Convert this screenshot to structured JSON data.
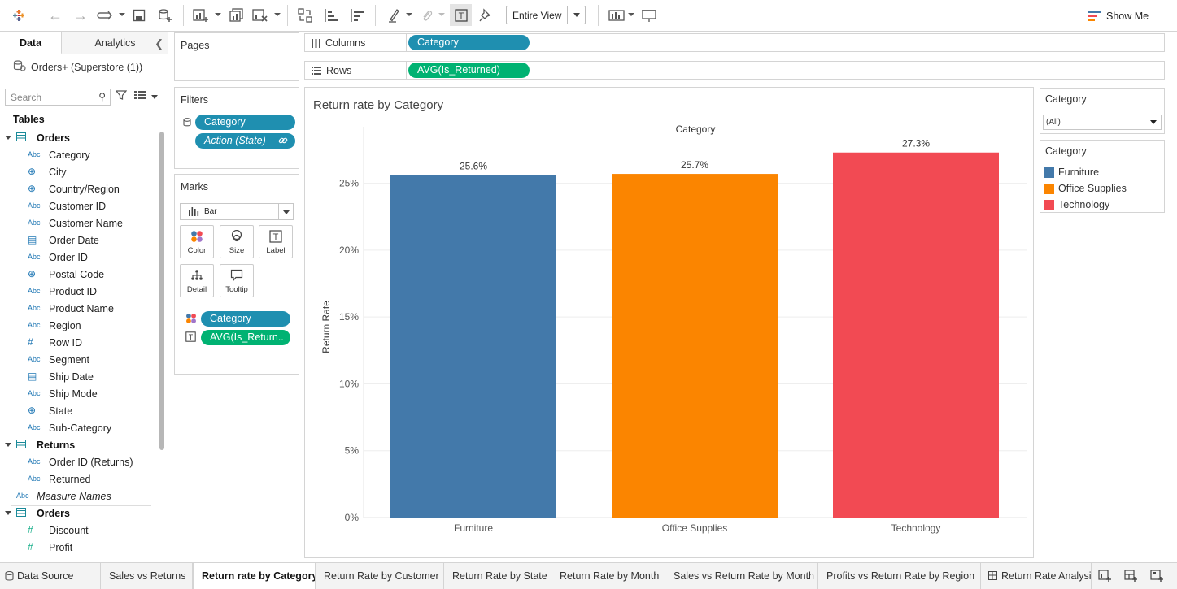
{
  "toolbar": {
    "fit_label": "Entire View",
    "show_me_label": "Show Me"
  },
  "data_pane": {
    "tabs": [
      "Data",
      "Analytics"
    ],
    "datasource": "Orders+ (Superstore (1))",
    "search_placeholder": "Search",
    "tables_label": "Tables",
    "fields": [
      {
        "kind": "table",
        "name": "Orders"
      },
      {
        "kind": "abc",
        "name": "Category"
      },
      {
        "kind": "geo",
        "name": "City"
      },
      {
        "kind": "geo",
        "name": "Country/Region"
      },
      {
        "kind": "abc",
        "name": "Customer ID"
      },
      {
        "kind": "abc",
        "name": "Customer Name"
      },
      {
        "kind": "date",
        "name": "Order Date"
      },
      {
        "kind": "abc",
        "name": "Order ID"
      },
      {
        "kind": "geo",
        "name": "Postal Code"
      },
      {
        "kind": "abc",
        "name": "Product ID"
      },
      {
        "kind": "abc",
        "name": "Product Name"
      },
      {
        "kind": "abc",
        "name": "Region"
      },
      {
        "kind": "num",
        "name": "Row ID"
      },
      {
        "kind": "abc",
        "name": "Segment"
      },
      {
        "kind": "date",
        "name": "Ship Date"
      },
      {
        "kind": "abc",
        "name": "Ship Mode"
      },
      {
        "kind": "geo",
        "name": "State"
      },
      {
        "kind": "abc",
        "name": "Sub-Category"
      },
      {
        "kind": "table",
        "name": "Returns"
      },
      {
        "kind": "abc",
        "name": "Order ID (Returns)"
      },
      {
        "kind": "abc",
        "name": "Returned"
      },
      {
        "kind": "mn",
        "name": "Measure Names"
      },
      {
        "kind": "table",
        "name": "Orders"
      },
      {
        "kind": "measure",
        "name": "Discount"
      },
      {
        "kind": "measure",
        "name": "Profit"
      }
    ]
  },
  "pages_card": {
    "title": "Pages"
  },
  "filters_card": {
    "title": "Filters",
    "pills": [
      "Category",
      "Action (State)"
    ]
  },
  "marks_card": {
    "title": "Marks",
    "mark_type": "Bar",
    "buttons": [
      "Color",
      "Size",
      "Label",
      "Detail",
      "Tooltip"
    ],
    "pills": [
      "Category",
      "AVG(Is_Return.."
    ]
  },
  "shelves": {
    "columns_label": "Columns",
    "columns_pill": "Category",
    "rows_label": "Rows",
    "rows_pill": "AVG(Is_Returned)"
  },
  "chart_data": {
    "type": "bar",
    "title": "Return rate by Category",
    "column_header": "Category",
    "ylabel": "Return Rate",
    "categories": [
      "Furniture",
      "Office Supplies",
      "Technology"
    ],
    "values": [
      25.6,
      25.7,
      27.3
    ],
    "value_labels": [
      "25.6%",
      "25.7%",
      "27.3%"
    ],
    "colors": [
      "#4379aa",
      "#fb8500",
      "#f24a53"
    ],
    "yticks": [
      "0%",
      "5%",
      "10%",
      "15%",
      "20%",
      "25%"
    ],
    "ytick_values": [
      0,
      5,
      10,
      15,
      20,
      25
    ],
    "ylim": [
      0,
      28.5
    ],
    "grid": true
  },
  "right_panel": {
    "filter_title": "Category",
    "filter_value": "(All)",
    "legend_title": "Category",
    "legend": [
      {
        "label": "Furniture",
        "color": "#4379aa"
      },
      {
        "label": "Office Supplies",
        "color": "#fb8500"
      },
      {
        "label": "Technology",
        "color": "#f24a53"
      }
    ]
  },
  "bottom_tabs": {
    "datasource": "Data Source",
    "sheets": [
      "Sales vs Returns",
      "Return rate by Category",
      "Return Rate by Customer",
      "Return Rate by State",
      "Return Rate by Month",
      "Sales vs Return Rate by Month",
      "Profits vs Return Rate by Region",
      "Return Rate Analysis"
    ]
  }
}
